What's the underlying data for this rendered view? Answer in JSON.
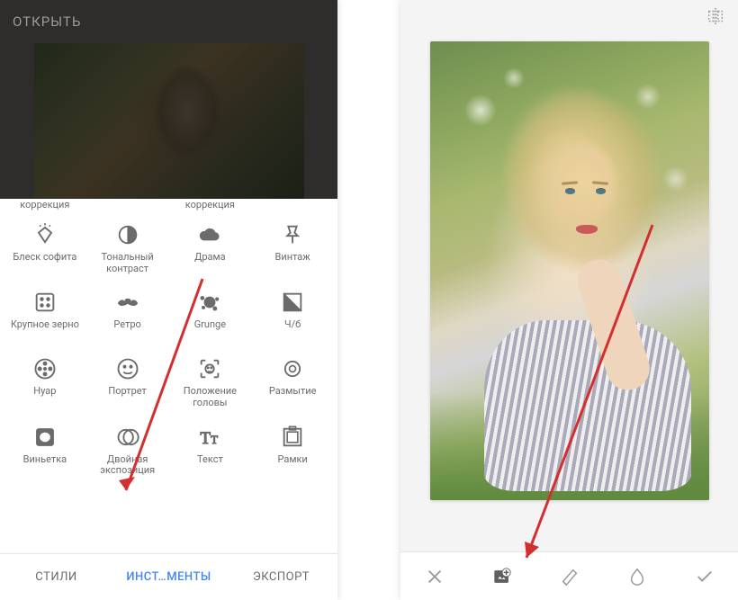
{
  "left": {
    "header": {
      "open_label": "ОТКРЫТЬ"
    },
    "tools_partial_row": [
      {
        "label": "коррекция"
      },
      {
        "label": ""
      },
      {
        "label": "коррекция"
      },
      {
        "label": ""
      }
    ],
    "tools": [
      {
        "id": "glamour-glow",
        "label": "Блеск софита",
        "icon": "diamond-glow"
      },
      {
        "id": "tonal-contrast",
        "label": "Тональный контраст",
        "icon": "half-circle"
      },
      {
        "id": "drama",
        "label": "Драма",
        "icon": "cloud"
      },
      {
        "id": "vintage",
        "label": "Винтаж",
        "icon": "pin"
      },
      {
        "id": "grainy-film",
        "label": "Крупное зерно",
        "icon": "dice"
      },
      {
        "id": "retrolux",
        "label": "Ретро",
        "icon": "mustache"
      },
      {
        "id": "grunge",
        "label": "Grunge",
        "icon": "splatter"
      },
      {
        "id": "bw",
        "label": "Ч/б",
        "icon": "bw-square"
      },
      {
        "id": "noir",
        "label": "Нуар",
        "icon": "film-reel"
      },
      {
        "id": "portrait",
        "label": "Портрет",
        "icon": "smiley"
      },
      {
        "id": "head-pose",
        "label": "Положение головы",
        "icon": "face-scan"
      },
      {
        "id": "lens-blur",
        "label": "Размытие",
        "icon": "blur-circle"
      },
      {
        "id": "vignette",
        "label": "Виньетка",
        "icon": "vignette-square"
      },
      {
        "id": "double-exposure",
        "label": "Двойная экспозиция",
        "icon": "double-circle"
      },
      {
        "id": "text",
        "label": "Текст",
        "icon": "text-tt"
      },
      {
        "id": "frames",
        "label": "Рамки",
        "icon": "frame"
      }
    ],
    "tabs": {
      "styles": "СТИЛИ",
      "tools": "ИНСТ…МЕНТЫ",
      "export": "ЭКСПОРТ",
      "active": "tools"
    }
  },
  "right": {
    "toolbar_icons": {
      "close": "close",
      "add_image": "add-image",
      "blend": "blend",
      "opacity": "opacity",
      "apply": "check",
      "active": "add_image"
    },
    "top_icon": "compare"
  }
}
